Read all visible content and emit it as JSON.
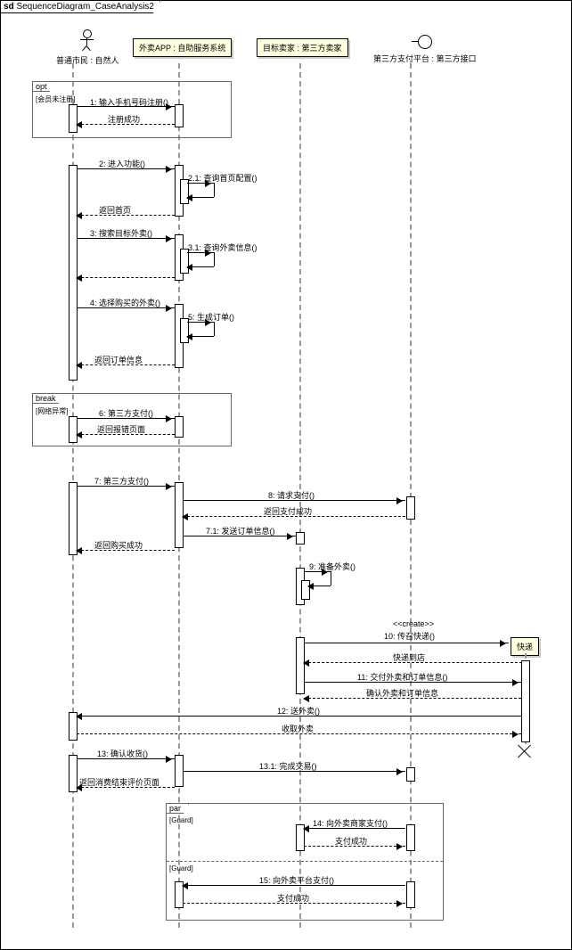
{
  "diagram_title_prefix": "sd",
  "diagram_title": "SequenceDiagram_CaseAnalysis2",
  "lifelines": {
    "citizen": "普通市民 : 自然人",
    "app": "外卖APP : 自助服务系统",
    "merchant": "目标卖家 : 第三方卖家",
    "payment": "第三方支付平台 : 第三方接口",
    "courier": "快递"
  },
  "fragments": {
    "opt": {
      "label": "opt",
      "guard": "[会员未注册]"
    },
    "break": {
      "label": "break",
      "guard": "[网络异常]"
    },
    "par": {
      "label": "par",
      "guard1": "[Guard]",
      "guard2": "[Guard]"
    }
  },
  "stereotype_create": "<<create>>",
  "messages": {
    "m1": "1: 输入手机号码注册()",
    "r1": "注册成功",
    "m2": "2: 进入功能()",
    "m2_1": "2.1: 查询首页配置()",
    "r2": "返回首页",
    "m3": "3: 搜索目标外卖()",
    "m3_1": "3.1: 查询外卖信息()",
    "m4": "4: 选择购买的外卖()",
    "m5": "5: 生成订单()",
    "r5": "返回订单信息",
    "m6": "6: 第三方支付()",
    "r6": "返回报错页面",
    "m7": "7: 第三方支付()",
    "m8": "8: 请求支付()",
    "r8": "返回支付成功",
    "m7_1": "7.1: 发送订单信息()",
    "r7": "返回购买成功",
    "m9": "9: 准备外卖()",
    "m10": "10: 传召快递()",
    "r10": "快递到店",
    "m11": "11: 交付外卖和订单信息()",
    "r11": "确认外卖和订单信息",
    "m12": "12: 送外卖()",
    "r12": "收取外卖",
    "m13": "13: 确认收货()",
    "m13_1": "13.1: 完成交易()",
    "r13": "返回消费结束评价页面",
    "m14": "14: 向外卖商家支付()",
    "r14": "支付成功",
    "m15": "15: 向外卖平台支付()",
    "r15": "支付成功"
  }
}
